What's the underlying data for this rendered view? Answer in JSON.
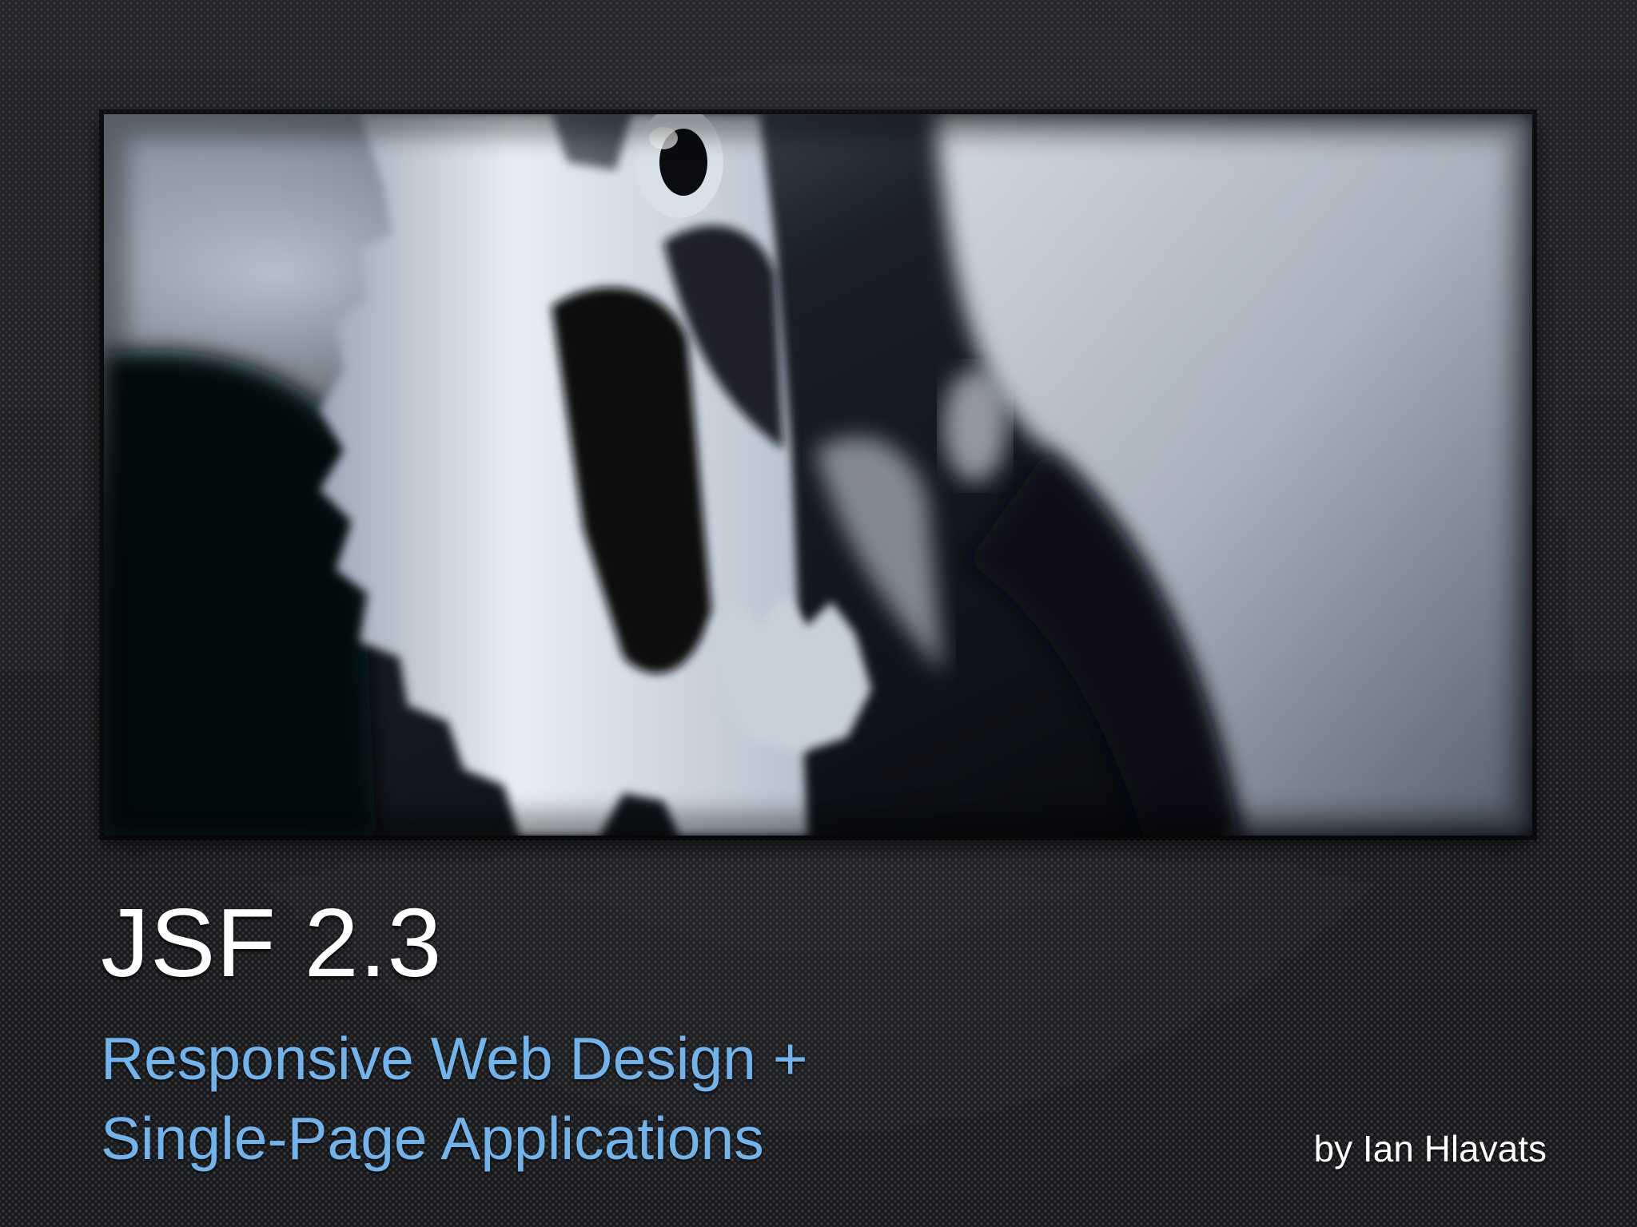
{
  "slide": {
    "title": "JSF 2.3",
    "subtitle_lines": [
      "Responsive Web Design +",
      "Single-Page Applications"
    ],
    "author": "by Ian Hlavats"
  },
  "image": {
    "icon": "gears-photo",
    "colors": {
      "background": "#1b1c1e",
      "title": "#ffffff",
      "subtitle": "#74b2ea",
      "metal_light": "#dfe6ee",
      "metal_dark": "#0a0c12"
    }
  }
}
